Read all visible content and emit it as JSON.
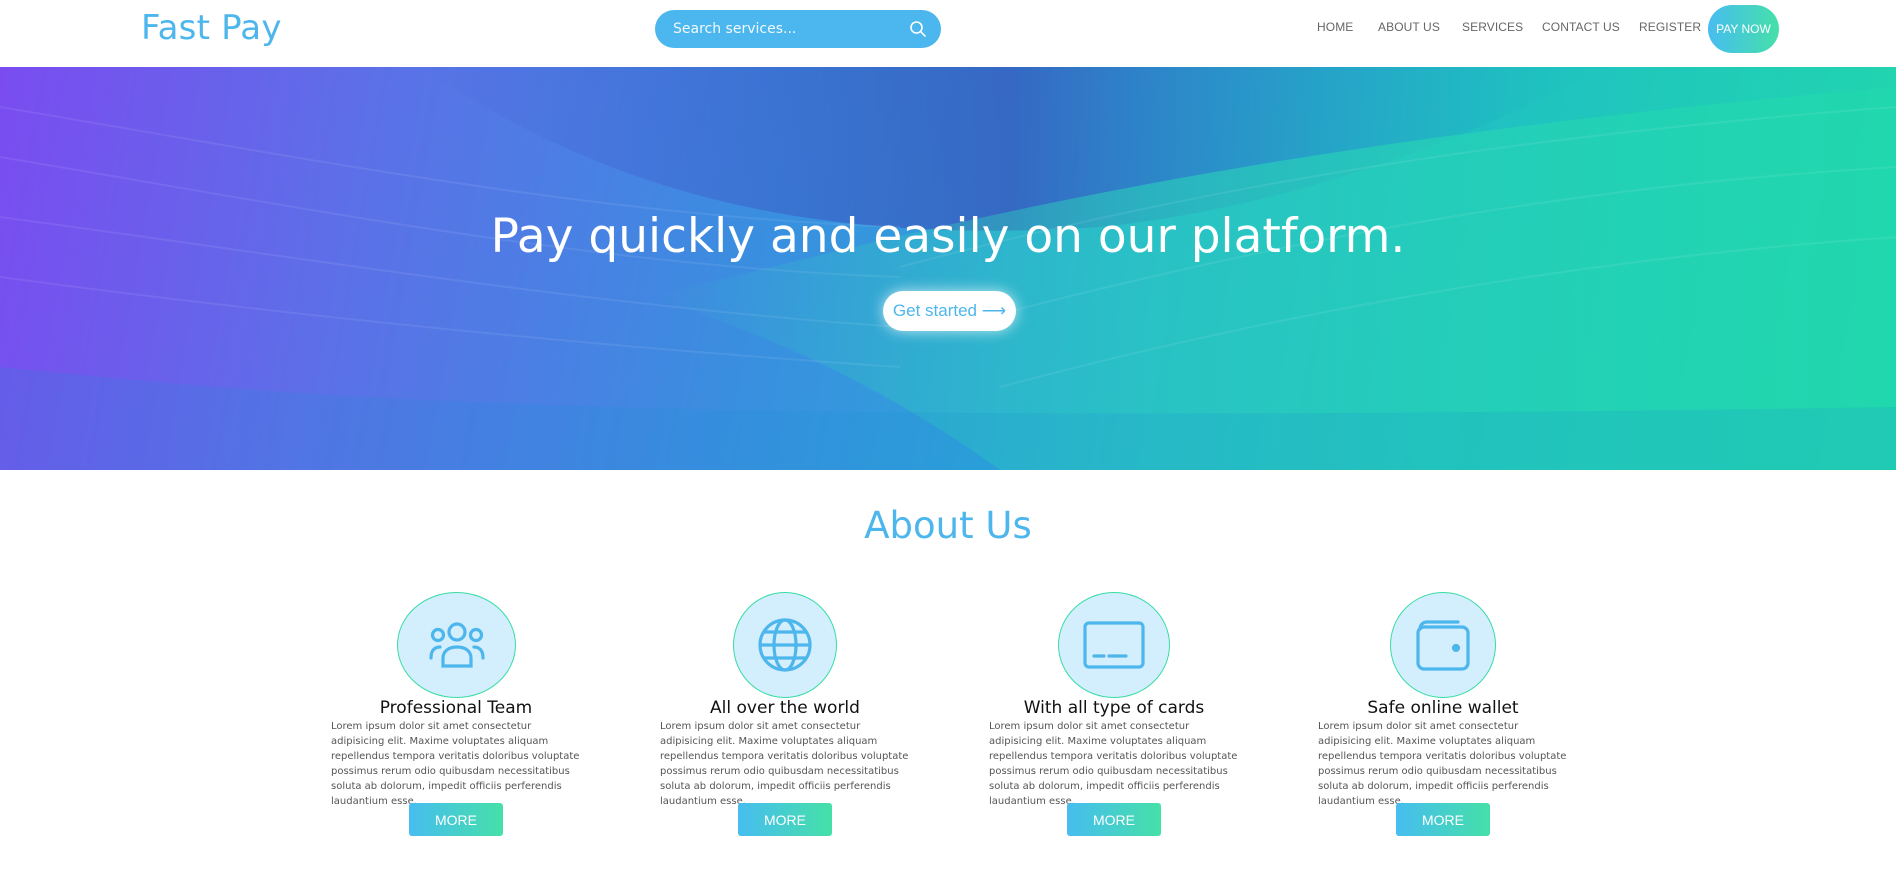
{
  "header": {
    "logo": "Fast Pay",
    "search_placeholder": "Search services...",
    "nav": [
      "HOME",
      "ABOUT US",
      "SERVICES",
      "CONTACT US",
      "REGISTER"
    ],
    "pay_now": "PAY NOW"
  },
  "hero": {
    "title": "Pay quickly and easily on our platform.",
    "cta": "Get started ⟶"
  },
  "about": {
    "title": "About Us",
    "cards": [
      {
        "icon": "team-icon",
        "title": "Professional Team",
        "text": "Lorem ipsum dolor sit amet consectetur adipisicing elit. Maxime voluptates aliquam repellendus tempora veritatis doloribus voluptate possimus rerum odio quibusdam necessitatibus soluta ab dolorum, impedit officiis perferendis laudantium esse.",
        "button": "MORE"
      },
      {
        "icon": "globe-icon",
        "title": "All over the world",
        "text": "Lorem ipsum dolor sit amet consectetur adipisicing elit. Maxime voluptates aliquam repellendus tempora veritatis doloribus voluptate possimus rerum odio quibusdam necessitatibus soluta ab dolorum, impedit officiis perferendis laudantium esse.",
        "button": "MORE"
      },
      {
        "icon": "card-icon",
        "title": "With all type of cards",
        "text": "Lorem ipsum dolor sit amet consectetur adipisicing elit. Maxime voluptates aliquam repellendus tempora veritatis doloribus voluptate possimus rerum odio quibusdam necessitatibus soluta ab dolorum, impedit officiis perferendis laudantium esse.",
        "button": "MORE"
      },
      {
        "icon": "wallet-icon",
        "title": "Safe online wallet",
        "text": "Lorem ipsum dolor sit amet consectetur adipisicing elit. Maxime voluptates aliquam repellendus tempora veritatis doloribus voluptate possimus rerum odio quibusdam necessitatibus soluta ab dolorum, impedit officiis perferendis laudantium esse.",
        "button": "MORE"
      }
    ]
  },
  "colors": {
    "brand": "#4db6ec",
    "accent_gradient_start": "#47bdf0",
    "accent_gradient_end": "#45e0a8"
  }
}
